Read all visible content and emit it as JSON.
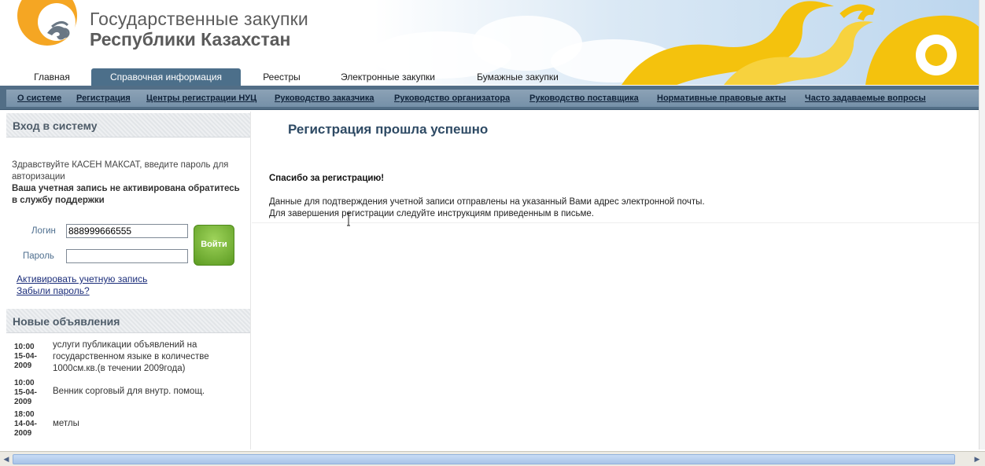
{
  "header": {
    "title_line1": "Государственные закупки",
    "title_line2": "Республики Казахстан"
  },
  "main_nav": [
    {
      "label": "Главная",
      "active": false
    },
    {
      "label": "Справочная информация",
      "active": true
    },
    {
      "label": "Реестры",
      "active": false
    },
    {
      "label": "Электронные закупки",
      "active": false
    },
    {
      "label": "Бумажные закупки",
      "active": false
    }
  ],
  "sub_nav": [
    "О системе",
    "Регистрация",
    "Центры регистрации НУЦ",
    "Руководство заказчика",
    "Руководство организатора",
    "Руководство поставщика",
    "Нормативные правовые акты",
    "Часто задаваемые вопросы"
  ],
  "login_box": {
    "heading": "Вход в систему",
    "greeting": "Здравствуйте КАСЕН МАКСАТ, введите пароль для авторизации",
    "warning": "Ваша учетная запись не активирована обратитесь в службу поддержки",
    "login_label": "Логин",
    "login_value": "888999666555",
    "password_label": "Пароль",
    "password_value": "",
    "submit_label": "Войти",
    "activate_link": "Активировать учетную запись",
    "forgot_link": "Забыли пароль?"
  },
  "news_box": {
    "heading": "Новые объявления",
    "items": [
      {
        "time": "10:00 15-04-2009",
        "text": "услуги публикации объявлений на государственном языке в количестве 1000см.кв.(в течении 2009года)"
      },
      {
        "time": "10:00 15-04-2009",
        "text": "Венник сорговый для внутр. помощ."
      },
      {
        "time": "18:00 14-04-2009",
        "text": "метлы"
      }
    ]
  },
  "content": {
    "title": "Регистрация прошла успешно",
    "thanks": "Спасибо за регистрацию!",
    "line1": "Данные для подтверждения учетной записи отправлены на указанный Вами адрес электронной почты.",
    "line2": "Для завершения регистрации следуйте инструкциям  приведенным в письме."
  },
  "colors": {
    "nav_active": "#4c6f8a",
    "subnav_bg": "#526e86",
    "title_color": "#2e4a64",
    "login_button": "#6aaa2c",
    "logo_orange": "#f5a623",
    "ornament_yellow": "#f4c20d"
  }
}
